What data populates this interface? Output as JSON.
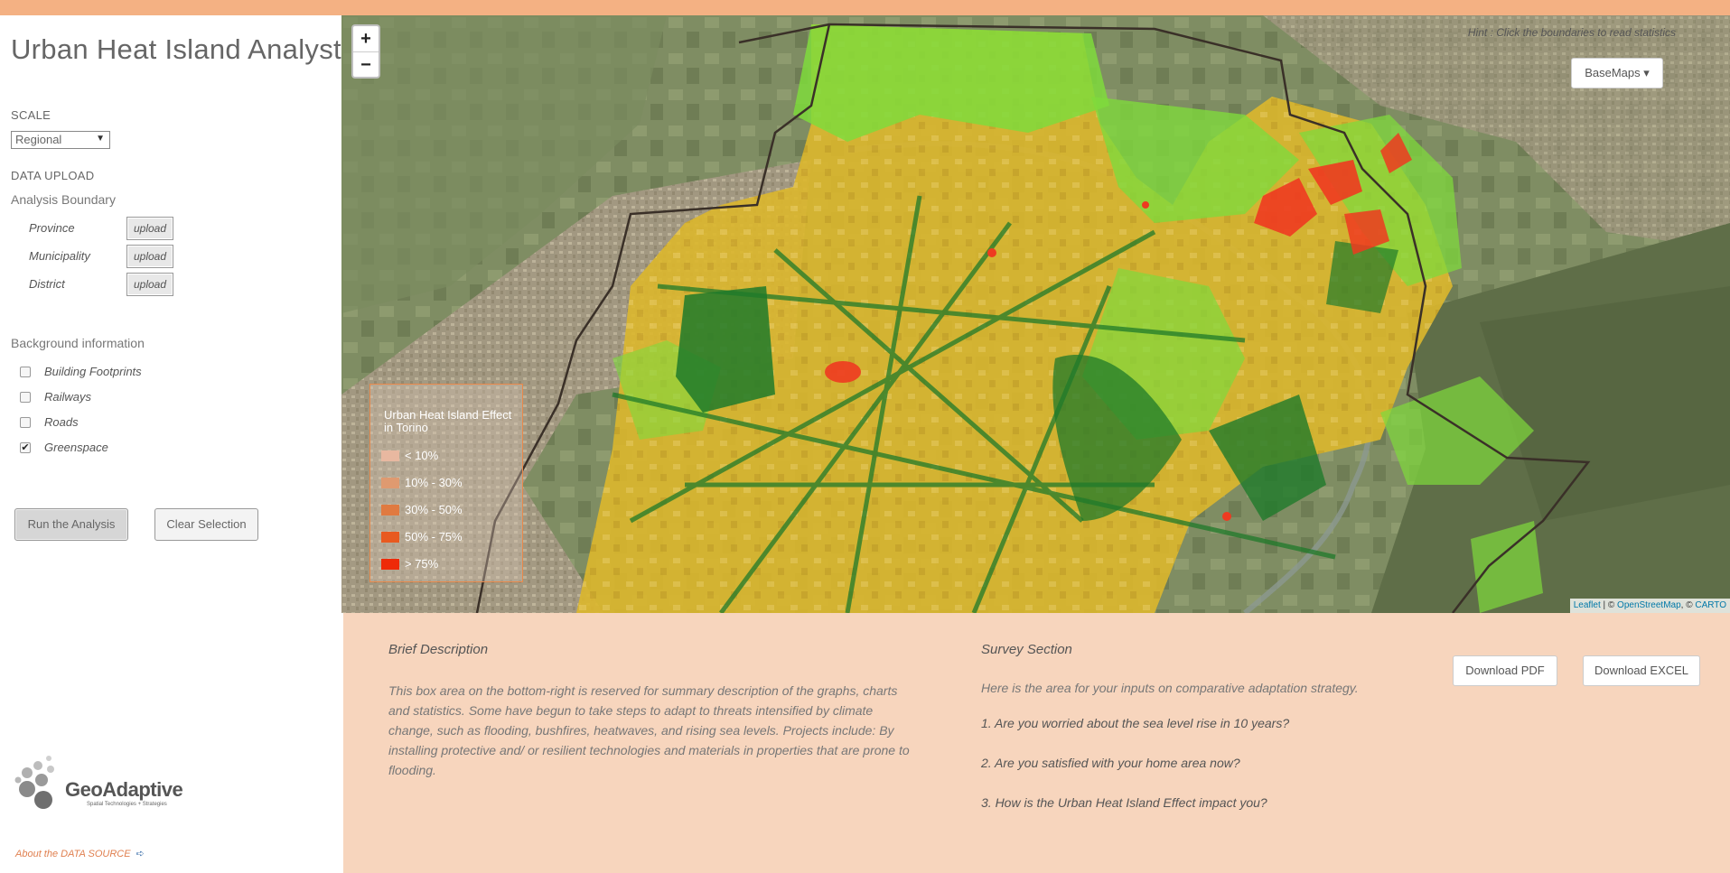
{
  "app": {
    "title": "Urban Heat Island Analyst"
  },
  "sidebar": {
    "scale_label": "SCALE",
    "scale_value": "Regional",
    "data_upload_label": "DATA UPLOAD",
    "analysis_boundary_label": "Analysis Boundary",
    "uploads": [
      {
        "label": "Province",
        "button": "upload"
      },
      {
        "label": "Municipality",
        "button": "upload"
      },
      {
        "label": "District",
        "button": "upload"
      }
    ],
    "background_label": "Background information",
    "layers": [
      {
        "label": "Building Footprints",
        "checked": false,
        "mark": ""
      },
      {
        "label": "Railways",
        "checked": false,
        "mark": ""
      },
      {
        "label": "Roads",
        "checked": false,
        "mark": ""
      },
      {
        "label": "Greenspace",
        "checked": true,
        "mark": "✔"
      }
    ],
    "run_button": "Run the Analysis",
    "clear_button": "Clear Selection",
    "logo_text": "GeoAdaptive",
    "logo_tagline": "Spatial Technologies + Strategies",
    "about_link": "About the DATA SOURCE"
  },
  "map": {
    "zoom_in": "+",
    "zoom_out": "−",
    "hint": "Hint : Click the boundaries to read statistics",
    "basemaps_label": "BaseMaps ▾",
    "legend": {
      "title": "Urban Heat Island Effect in Torino",
      "items": [
        {
          "label": "< 10%",
          "color": "#e8b8a0"
        },
        {
          "label": "10% - 30%",
          "color": "#df9a70"
        },
        {
          "label": "30% - 50%",
          "color": "#e07a40"
        },
        {
          "label": "50% - 75%",
          "color": "#e85a20"
        },
        {
          "label": "> 75%",
          "color": "#ee2a08"
        }
      ]
    },
    "attribution": {
      "leaflet": "Leaflet",
      "sep1": " | © ",
      "osm": "OpenStreetMap",
      "sep2": ", © ",
      "carto": "CARTO"
    }
  },
  "bottom": {
    "desc_title": "Brief Description",
    "desc_text": "This box area on the bottom-right is reserved for summary description of the graphs, charts and statistics. Some have begun to take steps to adapt to threats intensified by climate change, such as flooding, bushfires, heatwaves, and rising sea levels. Projects include: By installing protective and/ or resilient technologies and materials in properties that are prone to flooding.",
    "survey_title": "Survey Section",
    "survey_intro": "Here is the area for your inputs on comparative adaptation strategy.",
    "questions": [
      "1. Are you worried about the sea level rise in 10 years?",
      "2. Are you satisfied with your home area now?",
      "3. How is the Urban Heat Island Effect impact you?"
    ],
    "download_pdf": "Download PDF",
    "download_excel": "Download EXCEL"
  },
  "colors": {
    "topbar": "#f4b183",
    "panel": "#f7d5bd",
    "uhi_yellow": "#e2b52a",
    "uhi_green": "#7bd93a",
    "uhi_darkgreen": "#1f7a2a",
    "uhi_red": "#ee3a20"
  }
}
